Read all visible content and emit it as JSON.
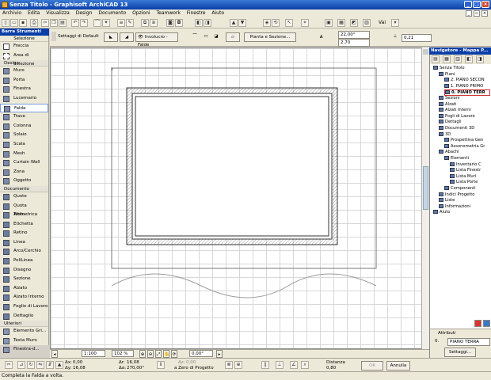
{
  "window": {
    "title": "Senza Titolo - Graphisoft ArchiCAD 13"
  },
  "menu": [
    "Archivio",
    "Edita",
    "Visualizza",
    "Design",
    "Documento",
    "Opzioni",
    "Teamwork",
    "Finestre",
    "Aiuto"
  ],
  "toolbox": {
    "title": "Barra Strumenti",
    "selection_header": "Selezione",
    "selection_items": [
      "Freccia",
      "Area di Selezione"
    ],
    "groups": [
      {
        "name": "Design",
        "items": [
          "Muro",
          "Porta",
          "Finestra",
          "Lucernario",
          "Falda",
          "Trave",
          "Colonna",
          "Solaio",
          "Scala",
          "Mesh",
          "Curtain Wall",
          "Zona",
          "Oggetto"
        ]
      },
      {
        "name": "Documento",
        "items": [
          "Quote",
          "Quota Altimetrica",
          "Testo",
          "Etichetta",
          "Retino",
          "Linea",
          "Arco/Cerchio",
          "PoliLinea",
          "Disegno",
          "Sezione",
          "Alzato",
          "Alzato Interno",
          "Foglio di Lavoro",
          "Dettaglio"
        ]
      },
      {
        "name": "Ulteriori",
        "items": [
          "Elemento Gri...",
          "Testa Muro",
          "Finestra-d..."
        ]
      }
    ],
    "active_item": "Falda"
  },
  "infobox": {
    "default_settings": "Settaggi di Default",
    "geometry": "Involucro - Falde",
    "floor_plan_button": "Pianta e Sezione...",
    "angle": "22,00°",
    "thickness": "2,70",
    "offset": "0,21"
  },
  "navigator": {
    "title": "Navigatore - Mappa P...",
    "tree": [
      {
        "label": "Senza Titolo",
        "level": 0
      },
      {
        "label": "Piani",
        "level": 1
      },
      {
        "label": "2. PIANO SECON",
        "level": 2
      },
      {
        "label": "1. PIANO PRIMO",
        "level": 2
      },
      {
        "label": "0. PIANO TERR",
        "level": 2,
        "selected": true
      },
      {
        "label": "Sezioni",
        "level": 1
      },
      {
        "label": "Alzati",
        "level": 1
      },
      {
        "label": "Alzati Interni",
        "level": 1
      },
      {
        "label": "Fogli di Lavoro",
        "level": 1
      },
      {
        "label": "Dettagli",
        "level": 1
      },
      {
        "label": "Documenti 3D",
        "level": 1
      },
      {
        "label": "3D",
        "level": 1
      },
      {
        "label": "Prospettiva Gen",
        "level": 2
      },
      {
        "label": "Assonometria Gr",
        "level": 2
      },
      {
        "label": "Abachi",
        "level": 1
      },
      {
        "label": "Elementi",
        "level": 2
      },
      {
        "label": "Inventario C",
        "level": 3
      },
      {
        "label": "Lista Finestr",
        "level": 3
      },
      {
        "label": "Lista Muri",
        "level": 3
      },
      {
        "label": "Lista Porte",
        "level": 3
      },
      {
        "label": "Componenti",
        "level": 2
      },
      {
        "label": "Indici Progetto",
        "level": 1
      },
      {
        "label": "Liste",
        "level": 1
      },
      {
        "label": "Informazioni",
        "level": 1
      },
      {
        "label": "Aiuto",
        "level": 0
      }
    ],
    "attributes_label": "Attributi",
    "floor_value": "PIANO TERRA",
    "floor_prefix": "0.",
    "settings_button": "Settaggi..."
  },
  "bottom": {
    "scale": "1:100",
    "zoom": "102 %",
    "angle": "0,00°"
  },
  "infobar": {
    "dx_label": "Δx:",
    "dx": "0,00",
    "dy_label": "Δy:",
    "dy": "16,08",
    "dr_label": "Δr:",
    "dr": "16,08",
    "da_label": "Δa:",
    "da": "270,00°",
    "dz_label": "Δz:",
    "dz": "0,00",
    "ref": "a Zero di Progetto",
    "distance_label": "Distanza",
    "distance": "0,80",
    "ok_button": "OK",
    "cancel_button": "Annulla"
  },
  "status": "Completa la Falda a volta.",
  "toolbar": {
    "view_label": "Vai"
  }
}
